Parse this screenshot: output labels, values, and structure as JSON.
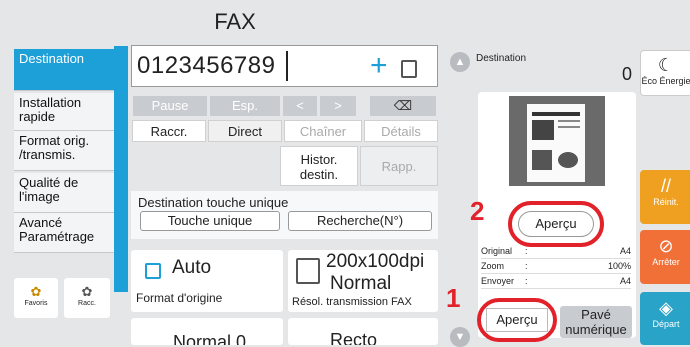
{
  "title": "FAX",
  "sidebar": {
    "items": [
      {
        "label": "Destination"
      },
      {
        "label": "Installation rapide"
      },
      {
        "label": "Format orig. /transmis."
      },
      {
        "label": "Qualité de l'image"
      },
      {
        "label": "Avancé Paramétrage"
      }
    ],
    "favorites_label": "Favoris",
    "shortcut_label": "Racc."
  },
  "fax_input": {
    "value": "0123456789"
  },
  "keys": {
    "pause": "Pause",
    "space": "Esp."
  },
  "tabs": {
    "raccr": "Raccr.",
    "direct": "Direct",
    "chainer": "Chaîner",
    "details": "Détails"
  },
  "histor_label": "Histor. destin.",
  "rapp_label": "Rapp.",
  "one_touch": {
    "heading": "Destination touche unique",
    "button": "Touche unique",
    "search": "Recherche(N°)"
  },
  "cards": {
    "orig": {
      "value": "Auto",
      "caption": "Format d'origine"
    },
    "res": {
      "value1": "200x100dpi",
      "value2": "Normal",
      "caption": "Résol. transmission FAX"
    },
    "bottom_left": "Normal 0",
    "bottom_right": "Recto"
  },
  "preview_panel": {
    "heading": "Destination",
    "count": "0",
    "apercu_preview_btn": "Aperçu",
    "rows": [
      {
        "label": "Original",
        "value": "A4"
      },
      {
        "label": "Zoom",
        "value": "100%"
      },
      {
        "label": "Envoyer",
        "value": "A4"
      }
    ],
    "apercu_btn": "Aperçu",
    "pave_btn": "Pavé numérique"
  },
  "right_buttons": {
    "eco": "Éco Énergie",
    "reset": "Réinit.",
    "stop": "Arrêter",
    "start": "Départ"
  },
  "markers": {
    "one": "1",
    "two": "2"
  },
  "colors": {
    "accent": "#1d9fd8",
    "reset": "#f0a020",
    "stop": "#f07038",
    "start": "#2aa3c8",
    "marker": "#e2222a"
  }
}
